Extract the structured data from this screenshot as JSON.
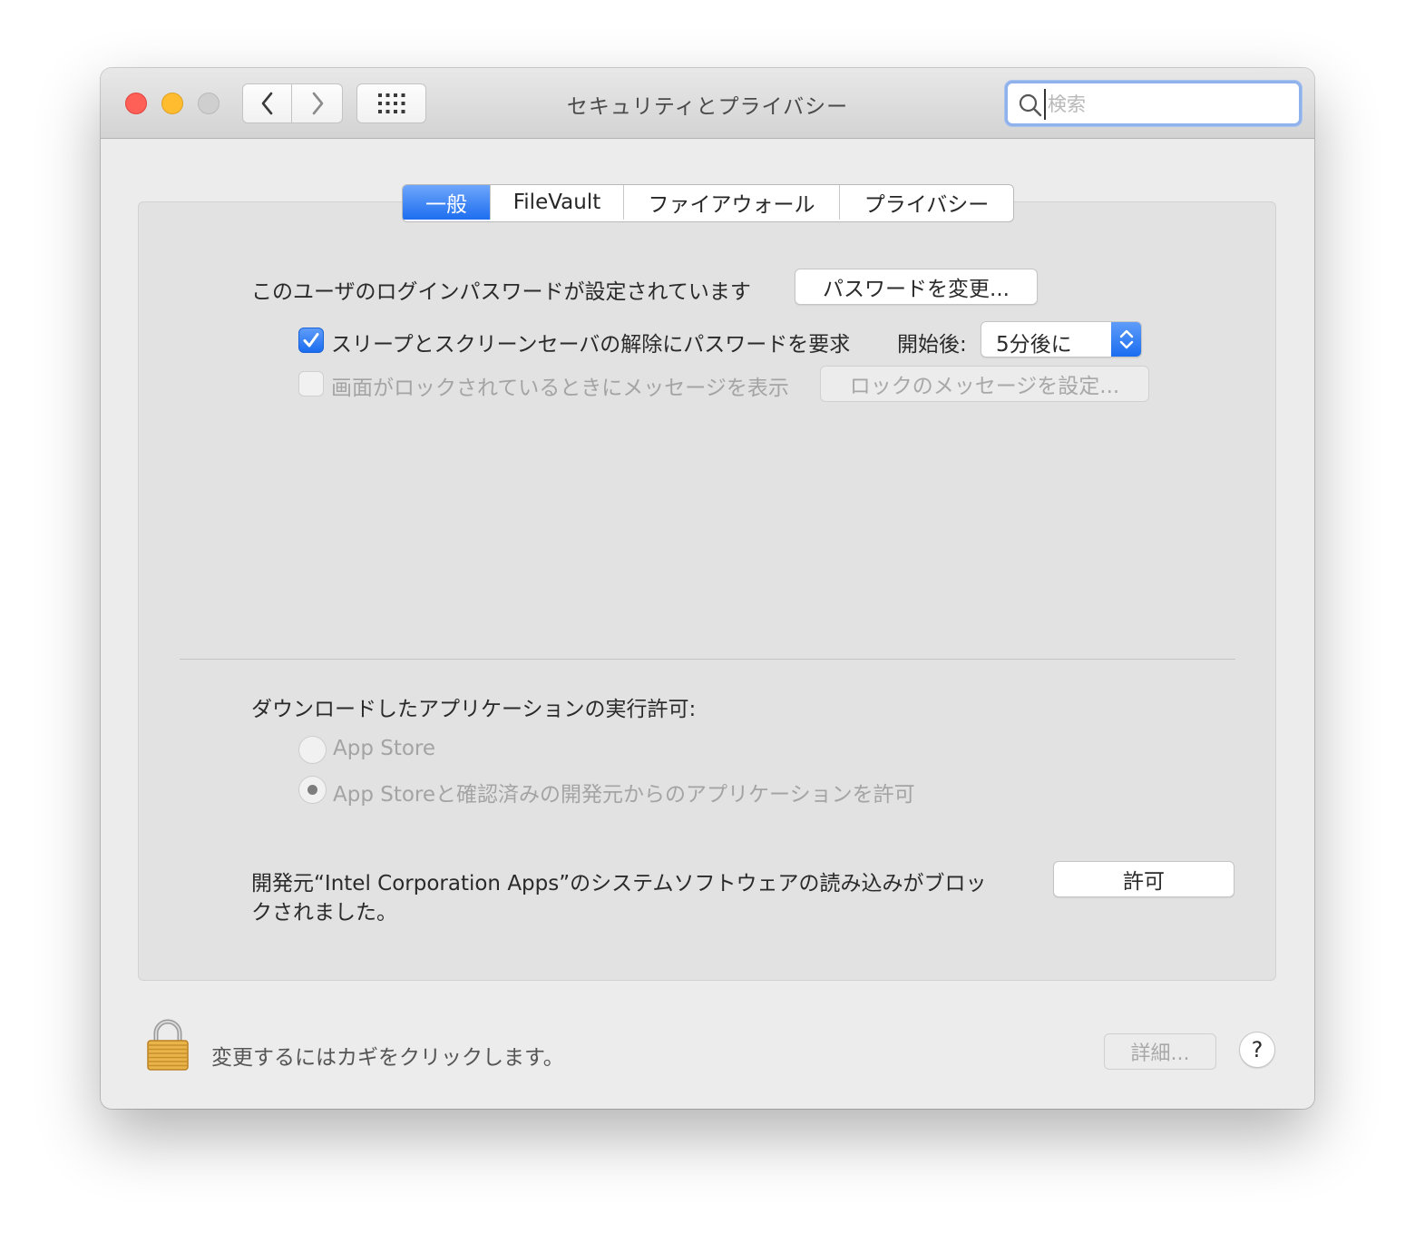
{
  "window": {
    "title": "セキュリティとプライバシー",
    "search_placeholder": "検索"
  },
  "tabs": [
    {
      "label": "一般",
      "active": true
    },
    {
      "label": "FileVault",
      "active": false
    },
    {
      "label": "ファイアウォール",
      "active": false
    },
    {
      "label": "プライバシー",
      "active": false
    }
  ],
  "general": {
    "password_status": "このユーザのログインパスワードが設定されています",
    "change_password_button": "パスワードを変更...",
    "require_password": {
      "label": "スリープとスクリーンセーバの解除にパスワードを要求",
      "checked": true,
      "after_label": "開始後:",
      "delay_value": "5分後に"
    },
    "lock_message": {
      "label": "画面がロックされているときにメッセージを表示",
      "checked": false,
      "button": "ロックのメッセージを設定..."
    },
    "downloads": {
      "heading": "ダウンロードしたアプリケーションの実行許可:",
      "options": [
        {
          "label": "App Store",
          "selected": false
        },
        {
          "label": "App Storeと確認済みの開発元からのアプリケーションを許可",
          "selected": true
        }
      ]
    },
    "blocked": {
      "line1": "開発元“Intel Corporation Apps”のシステムソフトウェアの読み込みがブロッ",
      "line2": "クされました。",
      "allow_button": "許可"
    }
  },
  "footer": {
    "lock_text": "変更するにはカギをクリックします。",
    "details_button": "詳細...",
    "help_button": "?"
  },
  "colors": {
    "accent": "#1d6ef0",
    "close": "#fe5f57",
    "minimize": "#febc2e",
    "zoom_inactive": "#cfcfcf"
  }
}
